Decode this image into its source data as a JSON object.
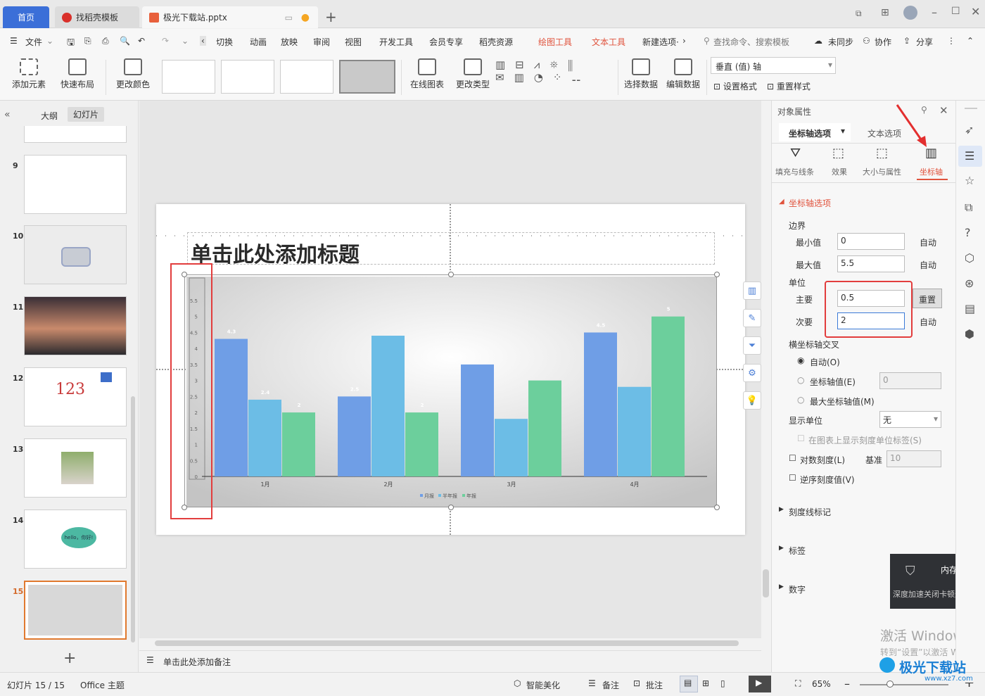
{
  "tabs": {
    "home": "首页",
    "template": "找稻壳模板",
    "doc": "极光下载站.pptx"
  },
  "menu": {
    "file": "文件",
    "items": [
      "切换",
      "动画",
      "放映",
      "审阅",
      "视图",
      "开发工具",
      "会员专享",
      "稻壳资源"
    ],
    "drawing_tools": "绘图工具",
    "text_tools": "文本工具",
    "new_options": "新建选项·",
    "search": "查找命令、搜索模板",
    "sync": "未同步",
    "collab": "协作",
    "share": "分享"
  },
  "ribbon": {
    "add_element": "添加元素",
    "quick_layout": "快速布局",
    "change_color": "更改颜色",
    "online_chart": "在线图表",
    "change_type": "更改类型",
    "select_data": "选择数据",
    "edit_data": "编辑数据",
    "axis_select": "垂直 (值) 轴",
    "set_format": "设置格式",
    "reset_style": "重置样式"
  },
  "left": {
    "outline": "大纲",
    "slides": "幻灯片",
    "nums": [
      "9",
      "10",
      "11",
      "12",
      "13",
      "14",
      "15"
    ],
    "s12_text": "123",
    "s14_text": "hello，你好!"
  },
  "slide": {
    "title": "单击此处添加标题",
    "notes": "单击此处添加备注"
  },
  "chart_data": {
    "type": "bar",
    "categories": [
      "1月",
      "2月",
      "3月",
      "4月"
    ],
    "series": [
      {
        "name": "月报",
        "values": [
          4.3,
          2.5,
          3.5,
          4.5
        ]
      },
      {
        "name": "半年报",
        "values": [
          2.4,
          4.4,
          1.8,
          2.8
        ]
      },
      {
        "name": "年报",
        "values": [
          2,
          2,
          3,
          5
        ]
      }
    ],
    "data_labels": [
      [
        "4.3",
        "2.4",
        "2"
      ],
      [
        "2.5",
        "",
        "2"
      ],
      [
        "",
        "",
        ""
      ],
      [
        "4.5",
        "",
        "5"
      ]
    ],
    "ylim": [
      0,
      5.5
    ],
    "yticks": [
      "0",
      "0.5",
      "1",
      "1.5",
      "2",
      "2.5",
      "3",
      "3.5",
      "4",
      "4.5",
      "5",
      "5.5"
    ],
    "colors": [
      "#6f9ee6",
      "#6cbde6",
      "#6ccf9c"
    ]
  },
  "pane": {
    "title": "对象属性",
    "tab_axis": "坐标轴选项",
    "tab_text": "文本选项",
    "sub": [
      "填充与线条",
      "效果",
      "大小与属性",
      "坐标轴"
    ],
    "section": "坐标轴选项",
    "bounds": "边界",
    "min": "最小值",
    "min_val": "0",
    "max": "最大值",
    "max_val": "5.5",
    "auto": "自动",
    "unit": "单位",
    "major": "主要",
    "major_val": "0.5",
    "minor": "次要",
    "minor_val": "2",
    "reset": "重置",
    "cross": "横坐标轴交叉",
    "auto_o": "自动(O)",
    "axis_val": "坐标轴值(E)",
    "axis_val_input": "0",
    "max_axis": "最大坐标轴值(M)",
    "display_unit": "显示单位",
    "display_unit_val": "无",
    "show_label": "在图表上显示刻度单位标签(S)",
    "log": "对数刻度(L)",
    "base": "基准",
    "base_val": "10",
    "reverse": "逆序刻度值(V)",
    "tick": "刻度线标记",
    "labels": "标签",
    "number": "数字",
    "toast_title": "内存已超标",
    "toast_body": "深度加速关闭卡顿进程"
  },
  "status": {
    "slide": "幻灯片 15 / 15",
    "theme": "Office 主题",
    "beautify": "智能美化",
    "notes": "备注",
    "comment": "批注",
    "zoom": "65%"
  },
  "watermark": {
    "line1": "激活 Windows",
    "line2": "转到“设置”以激活 Win",
    "site": "极光下载站",
    "url": "www.xz7.com"
  }
}
